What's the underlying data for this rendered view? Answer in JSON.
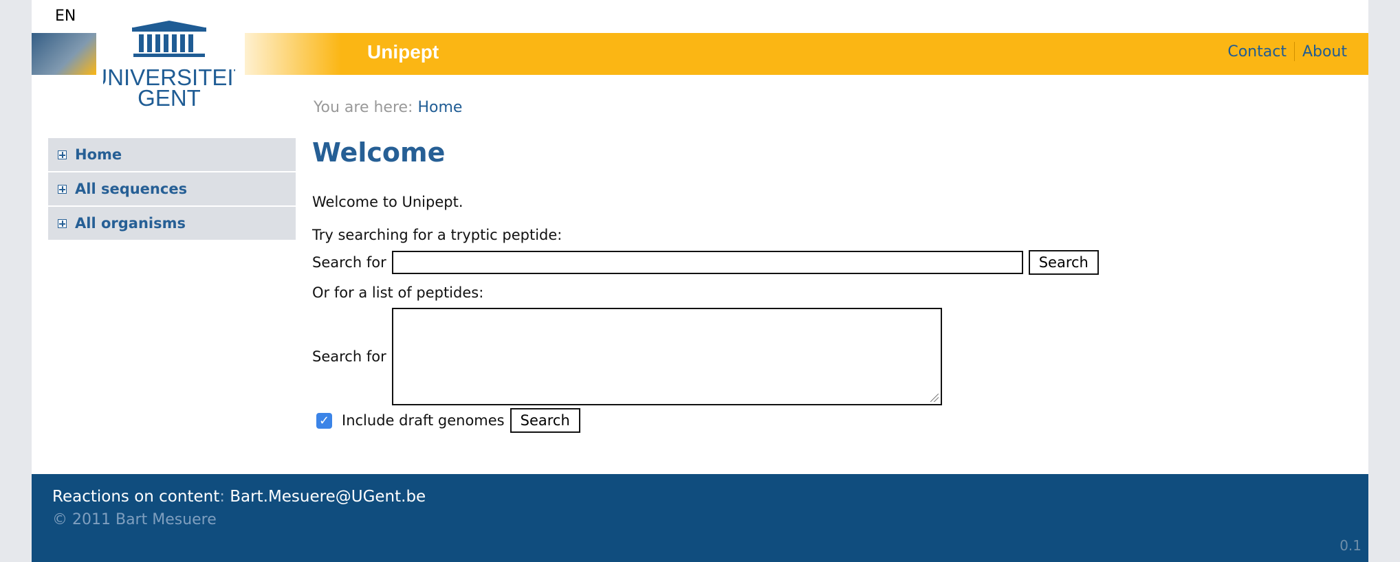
{
  "language": "EN",
  "site": {
    "title": "Unipept",
    "logo": {
      "line1": "UNIVERSITEIT",
      "line2": "GENT"
    }
  },
  "topnav": {
    "contact": "Contact",
    "about": "About"
  },
  "breadcrumb": {
    "prefix": "You are here:",
    "current": "Home"
  },
  "sidebar": {
    "items": [
      {
        "label": "Home"
      },
      {
        "label": "All sequences"
      },
      {
        "label": "All organisms"
      }
    ]
  },
  "main": {
    "heading": "Welcome",
    "intro": "Welcome to Unipept.",
    "single_prompt": "Try searching for a tryptic peptide:",
    "search_label": "Search for",
    "search_value": "",
    "search_button": "Search",
    "list_prompt": "Or for a list of peptides:",
    "list_label": "Search for",
    "list_value": "",
    "draft_label": "Include draft genomes",
    "draft_checked": true,
    "list_button": "Search"
  },
  "footer": {
    "reactions_label": "Reactions on content",
    "email": "Bart.Mesuere@UGent.be",
    "copyright": "© 2011 Bart Mesuere",
    "version": "0.1"
  },
  "colors": {
    "banner": "#fbb614",
    "primary": "#265f95",
    "footer": "#104d7e"
  }
}
